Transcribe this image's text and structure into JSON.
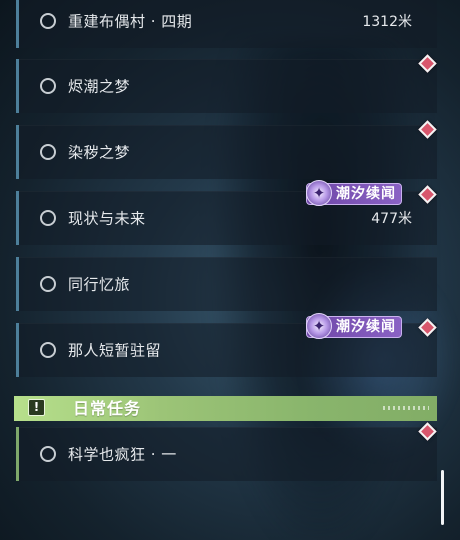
{
  "quests": [
    {
      "title": "重建布偶村 · 四期",
      "distance": "1312米"
    },
    {
      "title": "烬潮之梦",
      "distance": ""
    },
    {
      "title": "染秽之梦",
      "distance": ""
    },
    {
      "title": "现状与未来",
      "distance": "477米"
    },
    {
      "title": "同行忆旅",
      "distance": ""
    },
    {
      "title": "那人短暂驻留",
      "distance": ""
    }
  ],
  "badges": {
    "tide": "潮汐续闻",
    "tide_icon": "✦"
  },
  "daily_section": {
    "title": "日常任务",
    "icon": "!",
    "quests": [
      {
        "title": "科学也疯狂 · 一",
        "distance": ""
      }
    ]
  },
  "colors": {
    "accent_blue": "#4d7f9a",
    "daily_green": "#9cc477",
    "badge_purple": "#7a52b5",
    "marker_red": "#d8566c"
  },
  "icons": {
    "radio": "radio-unchecked-icon",
    "marker": "map-marker-diamond-icon",
    "tide": "tide-sparkle-icon",
    "alert": "alert-exclamation-icon"
  }
}
